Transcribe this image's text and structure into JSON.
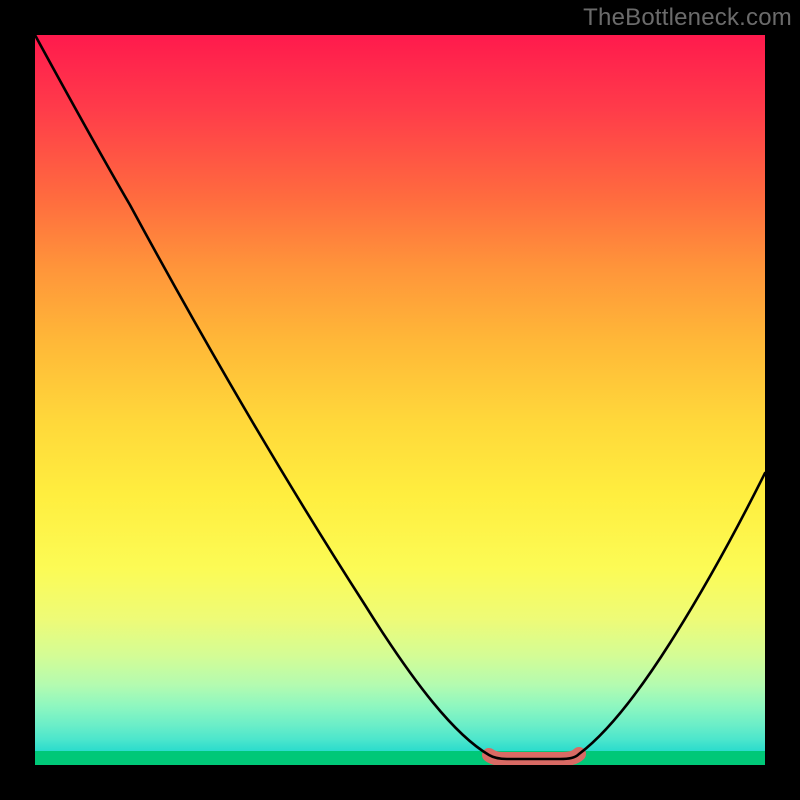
{
  "watermark": "TheBottleneck.com",
  "colors": {
    "background": "#000000",
    "curve": "#000000",
    "flat_segment": "#d96a64",
    "green_band": "#00c878"
  },
  "chart_data": {
    "type": "line",
    "title": "",
    "xlabel": "",
    "ylabel": "",
    "xlim": [
      0,
      100
    ],
    "ylim": [
      0,
      100
    ],
    "x": [
      0,
      5,
      10,
      15,
      20,
      25,
      30,
      35,
      40,
      45,
      50,
      55,
      60,
      63,
      67,
      71,
      75,
      80,
      85,
      90,
      95,
      100
    ],
    "values": [
      100,
      93,
      85,
      77,
      69,
      61,
      53,
      45,
      37,
      29,
      21,
      13,
      5,
      1,
      0,
      0,
      1,
      6,
      14,
      24,
      35,
      47
    ],
    "flat_segment": {
      "x_start": 63,
      "x_end": 75,
      "y": 0
    },
    "notes": "V-shaped bottleneck curve over vertical heat gradient; values estimated from pixel positions (y=0 at bottom/green, y=100 at top/red)."
  }
}
